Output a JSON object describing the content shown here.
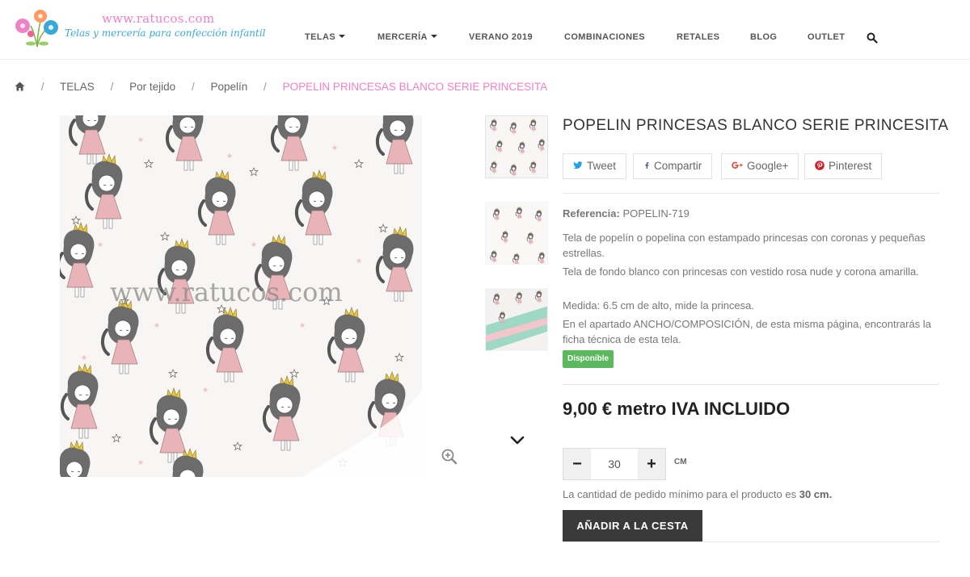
{
  "header": {
    "logo_url": "www.ratucos.com",
    "logo_tagline": "Telas y mercería para confección infantil",
    "nav": [
      {
        "label": "TELAS",
        "has_dropdown": true
      },
      {
        "label": "MERCERÍA",
        "has_dropdown": true
      },
      {
        "label": "VERANO 2019",
        "has_dropdown": false
      },
      {
        "label": "COMBINACIONES",
        "has_dropdown": false
      },
      {
        "label": "RETALES",
        "has_dropdown": false
      },
      {
        "label": "BLOG",
        "has_dropdown": false
      },
      {
        "label": "OUTLET",
        "has_dropdown": false
      }
    ],
    "search_icon": "search-icon"
  },
  "breadcrumb": {
    "home_icon": "home-icon",
    "items": [
      "TELAS",
      "Por tejido",
      "Popelín"
    ],
    "current": "POPELIN PRINCESAS BLANCO SERIE PRINCESITA",
    "separator": "/"
  },
  "gallery": {
    "watermark": "www.ratucos.com",
    "zoom_icon": "zoom-in-icon",
    "scroll_icon": "chevron-down-icon"
  },
  "product": {
    "title": "POPELIN PRINCESAS BLANCO SERIE PRINCESITA",
    "share": {
      "tweet": "Tweet",
      "facebook": "Compartir",
      "google": "Google+",
      "pinterest": "Pinterest"
    },
    "reference_label": "Referencia:",
    "reference_value": "POPELIN-719",
    "description": [
      "Tela de popelín o popelina con estampado princesas con coronas y pequeñas estrellas.",
      "Tela de fondo blanco con princesas con vestido rosa nude y corona amarilla.",
      "Medida: 6.5 cm de alto, mide la princesa.",
      "En el apartado ANCHO/COMPOSICIÓN, de esta misma página, encontrarás la ficha técnica de esta tela."
    ],
    "availability": "Disponible",
    "price": "9,00 € metro IVA INCLUIDO",
    "quantity": {
      "minus": "−",
      "value": "30",
      "plus": "+",
      "unit": "CM"
    },
    "min_order_text": "La cantidad de pedido mínimo para el producto es",
    "min_order_value": "30 cm.",
    "add_to_cart": "AÑADIR A LA CESTA"
  },
  "colors": {
    "accent_pink": "#ee82c8",
    "tagline_blue": "#3aa8d8",
    "available_green": "#5cb85c",
    "cart_button": "#3a3a3a"
  }
}
